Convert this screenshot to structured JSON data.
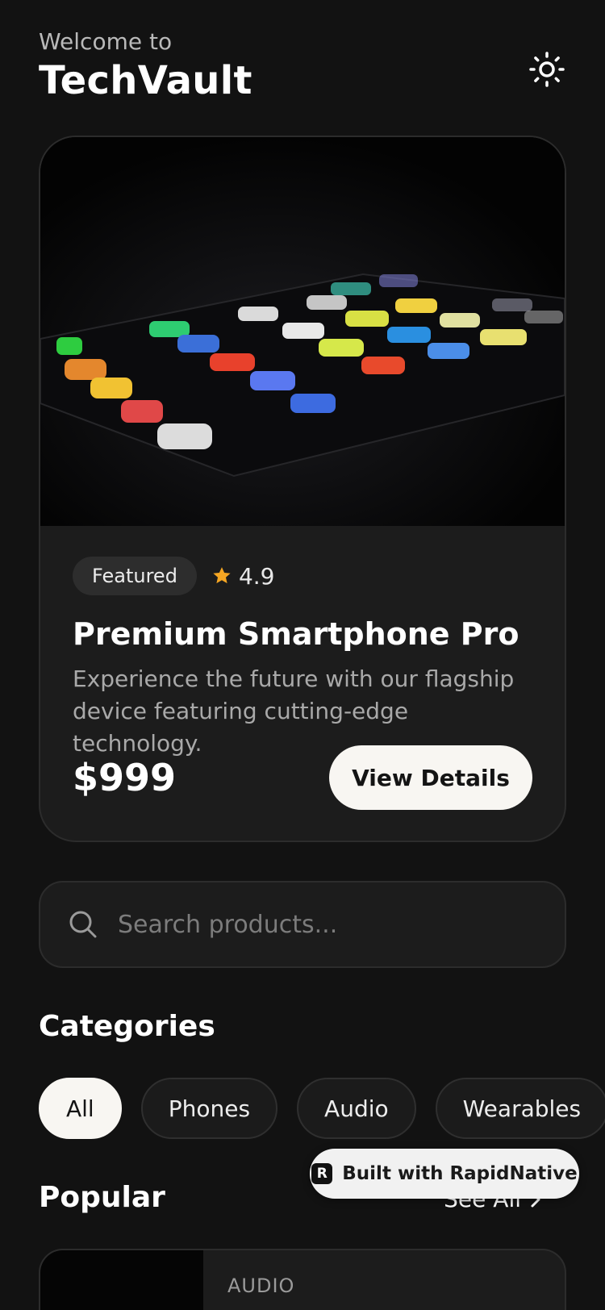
{
  "header": {
    "welcome": "Welcome to",
    "brand": "TechVault",
    "theme_icon": "sun-icon"
  },
  "featured": {
    "badge": "Featured",
    "rating": "4.9",
    "rating_icon": "star-icon",
    "title": "Premium Smartphone Pro",
    "description": "Experience the future with our flagship device featuring cutting-edge technology.",
    "price": "$999",
    "cta": "View Details",
    "image_icon": "smartphone-photo"
  },
  "search": {
    "placeholder": "Search products...",
    "icon": "search-icon"
  },
  "categories": {
    "title": "Categories",
    "items": [
      {
        "label": "All",
        "active": true
      },
      {
        "label": "Phones",
        "active": false
      },
      {
        "label": "Audio",
        "active": false
      },
      {
        "label": "Wearables",
        "active": false
      }
    ]
  },
  "popular": {
    "title": "Popular",
    "see_all": "See All",
    "first_item_category": "AUDIO"
  },
  "badge_overlay": {
    "label": "Built with RapidNative",
    "logo_letter": "R"
  },
  "colors": {
    "background": "#121212",
    "card": "#1c1c1c",
    "accent_star": "#f5a623",
    "button_light": "#f8f6f2"
  }
}
